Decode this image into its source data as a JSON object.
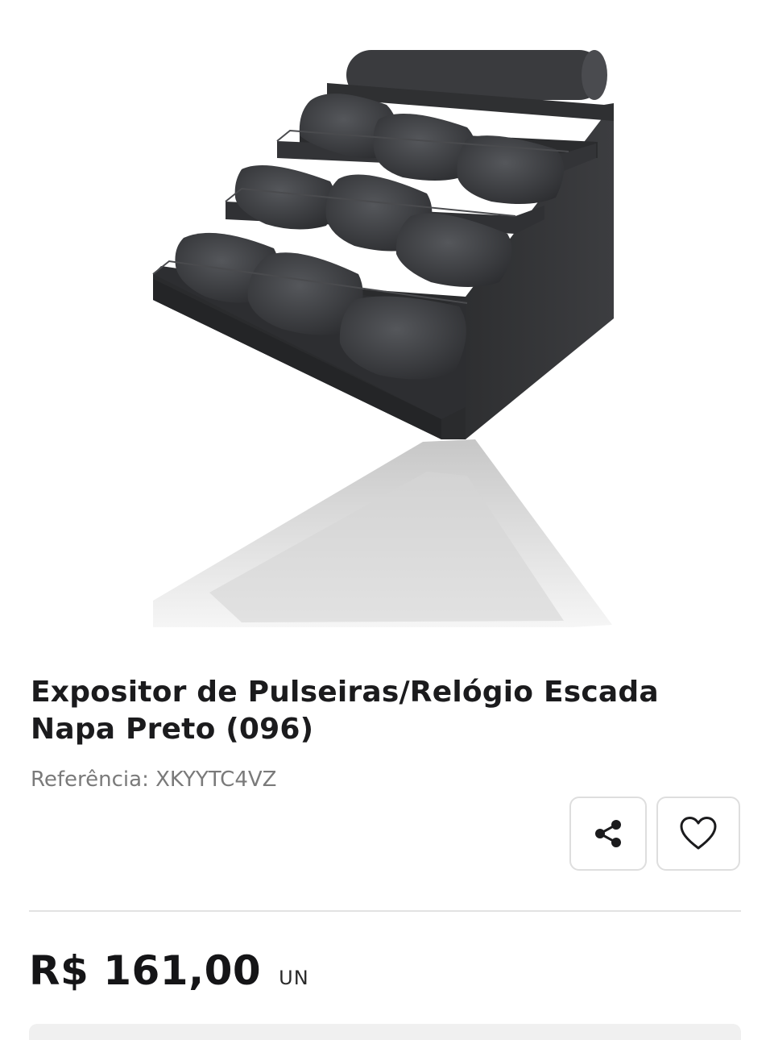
{
  "product": {
    "title": "Expositor de Pulseiras/Relógio Escada Napa Preto (096)",
    "reference": "Referência: XKYYTC4VZ",
    "price": "R$ 161,00",
    "unit": "UN",
    "image_icon": "watch-display-stand-image"
  },
  "actions": {
    "share_icon": "share-icon",
    "favorite_icon": "heart-icon"
  },
  "colors": {
    "text": "#1b1b1d",
    "muted": "#7a7a7a",
    "border": "#dedede"
  }
}
